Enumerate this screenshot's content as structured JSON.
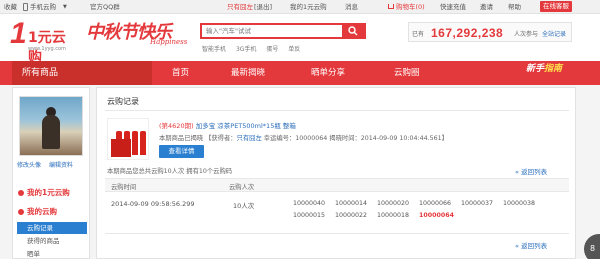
{
  "topbar": {
    "favorite": "收藏",
    "phone": "手机云购",
    "qq_group": "官方QQ群",
    "username": "只有囧左",
    "exit": "[退出]",
    "my_1yuan": "我的1元云购",
    "messages": "消息",
    "cart": "购物车(0)",
    "recharge": "快速充值",
    "invite": "邀请",
    "help": "帮助",
    "service": "在线客服"
  },
  "header": {
    "logo_text": "1元云购",
    "logo_url": "www.1yyg.com",
    "slogan_cn": "中秋节快乐",
    "slogan_en": "Happiness",
    "search_placeholder": "输入\"汽车\"试试",
    "hot_keywords": [
      "智能手机",
      "3G手机",
      "蛋号",
      "单反"
    ],
    "counter_prefix": "已有",
    "counter_value": "167,292,238",
    "counter_suffix": "人次参与",
    "counter_link": "全站记录"
  },
  "nav": {
    "all": "所有商品",
    "items": [
      "首页",
      "最新揭晓",
      "晒单分享",
      "云购圈"
    ],
    "guide_a": "新手",
    "guide_b": "指南"
  },
  "sidebar": {
    "edit_avatar": "修改头像",
    "edit_profile": "编辑资料",
    "section_my": "我的1元云购",
    "section_cloud": "我的云购",
    "items": [
      "云购记录",
      "获得的商品",
      "晒单"
    ]
  },
  "main": {
    "title": "云购记录",
    "product_round": "(第4620期)",
    "product_name": "加多宝 凉茶PET500ml*15瓶 整箱",
    "info_prefix": "本期商品已揭晓  【获得者：",
    "info_winner": "只有囧左",
    "info_suffix": "  幸运编号：10000064  揭晓时间：2014-09-09 10:04:44.561】",
    "detail_button": "查看详情",
    "summary": "本期商品您总共云购10人次 拥有10个云购码",
    "back_link": "返回列表",
    "col_time": "云购时间",
    "col_count": "云购人次",
    "row_time": "2014-09-09 09:58:56.299",
    "row_count": "10人次",
    "codes": [
      "10000040",
      "10000014",
      "10000020",
      "10000066",
      "10000037",
      "10000038",
      "10000015",
      "10000022",
      "10000018",
      "10000064"
    ],
    "winning_code": "10000064"
  },
  "float_badge": "8"
}
